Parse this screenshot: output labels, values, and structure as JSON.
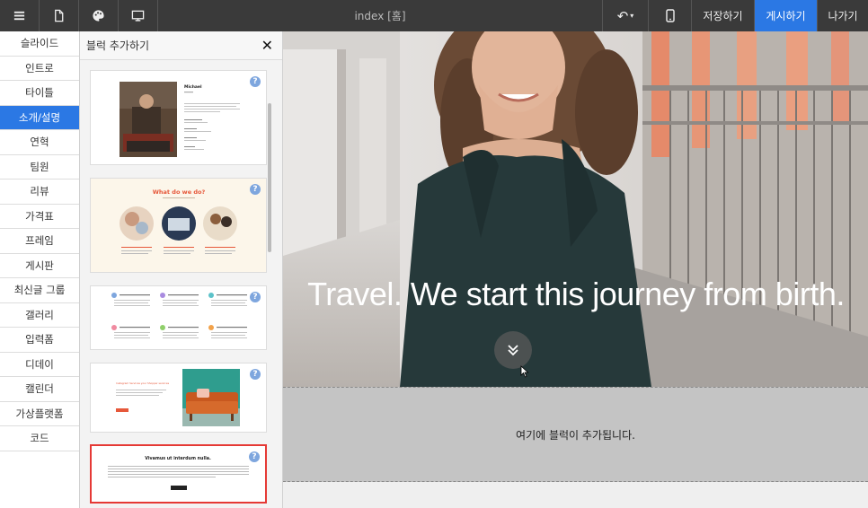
{
  "toolbar": {
    "icons": [
      "menu-icon",
      "file-icon",
      "palette-icon",
      "monitor-icon"
    ],
    "title": "index [홈]",
    "undo_icon": "undo-icon",
    "mobile_icon": "mobile-icon",
    "save_label": "저장하기",
    "publish_label": "게시하기",
    "exit_label": "나가기",
    "accent": "#2b78e4"
  },
  "categories": [
    {
      "label": "슬라이드"
    },
    {
      "label": "인트로"
    },
    {
      "label": "타이틀"
    },
    {
      "label": "소개/설명",
      "active": true
    },
    {
      "label": "연혁"
    },
    {
      "label": "팀원"
    },
    {
      "label": "리뷰"
    },
    {
      "label": "가격표"
    },
    {
      "label": "프레임"
    },
    {
      "label": "게시판"
    },
    {
      "label": "최신글 그룹"
    },
    {
      "label": "갤러리"
    },
    {
      "label": "입력폼"
    },
    {
      "label": "디데이"
    },
    {
      "label": "캘린더"
    },
    {
      "label": "가상플랫폼"
    },
    {
      "label": "코드"
    }
  ],
  "panel": {
    "title": "블럭 추가하기",
    "close_icon": "close-icon",
    "thumbnails": [
      {
        "id": "profile",
        "heading": "Michael"
      },
      {
        "id": "what-we-do",
        "heading": "What do we do?"
      },
      {
        "id": "features-grid",
        "heading": ""
      },
      {
        "id": "sofa",
        "heading": "Instagram Services your Shopper services"
      },
      {
        "id": "text-block",
        "heading": "Vivamus ut interdum nulla.",
        "selected": true
      }
    ]
  },
  "canvas": {
    "hero_title": "Travel. We start this journey from birth.",
    "scroll_icon": "chevron-double-down-icon",
    "drop_zone_text": "여기에 블럭이 추가됩니다."
  }
}
